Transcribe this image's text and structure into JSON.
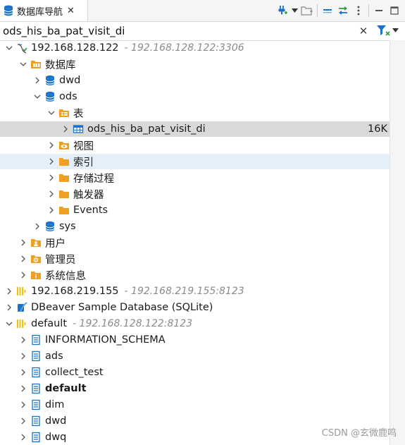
{
  "window": {
    "tab_title": "数据库导航",
    "close_label": "✕"
  },
  "toolbar": {
    "buttons": [
      {
        "icon": "new-connection-icon"
      },
      {
        "icon": "dropdown-arrow-icon"
      },
      {
        "icon": "new-folder-icon"
      },
      {
        "icon": "collapse-all-icon"
      },
      {
        "icon": "link-with-editor-icon"
      },
      {
        "icon": "view-menu-icon"
      },
      {
        "icon": "minimize-icon"
      },
      {
        "icon": "maximize-icon"
      }
    ]
  },
  "filter": {
    "value": "ods_his_ba_pat_visit_di",
    "clear_label": "✕"
  },
  "colors": {
    "chevron": "#555555",
    "database": "#1a73c8",
    "folder": "#f0a020",
    "connection": "#f2c200",
    "selected_row": "#d9d9d9",
    "hover_row": "#e5effa"
  },
  "tree": [
    {
      "level": 0,
      "chevron": "down",
      "icon": "mysql-connection-icon",
      "label": "192.168.128.122",
      "sub": " - 192.168.128.122:3306"
    },
    {
      "level": 1,
      "chevron": "down",
      "icon": "databases-folder-icon",
      "label": "数据库"
    },
    {
      "level": 2,
      "chevron": "right",
      "icon": "database-icon",
      "label": "dwd"
    },
    {
      "level": 2,
      "chevron": "down",
      "icon": "database-icon",
      "label": "ods"
    },
    {
      "level": 3,
      "chevron": "down",
      "icon": "tables-folder-icon",
      "label": "表"
    },
    {
      "level": 4,
      "chevron": "right",
      "icon": "table-icon",
      "label": "ods_his_ba_pat_visit_di",
      "size": "16K",
      "state": "selected"
    },
    {
      "level": 3,
      "chevron": "right",
      "icon": "views-folder-icon",
      "label": "视图"
    },
    {
      "level": 3,
      "chevron": "right",
      "icon": "folder-icon",
      "label": "索引",
      "state": "hover"
    },
    {
      "level": 3,
      "chevron": "right",
      "icon": "folder-icon",
      "label": "存储过程"
    },
    {
      "level": 3,
      "chevron": "right",
      "icon": "folder-icon",
      "label": "触发器"
    },
    {
      "level": 3,
      "chevron": "right",
      "icon": "folder-icon",
      "label": "Events"
    },
    {
      "level": 2,
      "chevron": "right",
      "icon": "database-icon",
      "label": "sys"
    },
    {
      "level": 1,
      "chevron": "right",
      "icon": "users-folder-icon",
      "label": "用户"
    },
    {
      "level": 1,
      "chevron": "right",
      "icon": "admin-folder-icon",
      "label": "管理员"
    },
    {
      "level": 1,
      "chevron": "right",
      "icon": "system-info-icon",
      "label": "系统信息"
    },
    {
      "level": 0,
      "chevron": "right",
      "icon": "clickhouse-connection-icon",
      "label": "192.168.219.155",
      "sub": " - 192.168.219.155:8123"
    },
    {
      "level": 0,
      "chevron": "right",
      "icon": "sqlite-connection-icon",
      "label": "DBeaver Sample Database (SQLite)"
    },
    {
      "level": 0,
      "chevron": "down",
      "icon": "clickhouse-connection-icon",
      "label": "default",
      "sub": " - 192.168.128.122:8123"
    },
    {
      "level": 1,
      "chevron": "right",
      "icon": "schema-icon",
      "label": "INFORMATION_SCHEMA"
    },
    {
      "level": 1,
      "chevron": "right",
      "icon": "schema-icon",
      "label": "ads"
    },
    {
      "level": 1,
      "chevron": "right",
      "icon": "schema-icon",
      "label": "collect_test"
    },
    {
      "level": 1,
      "chevron": "right",
      "icon": "schema-icon",
      "label": "default",
      "bold": true
    },
    {
      "level": 1,
      "chevron": "right",
      "icon": "schema-icon",
      "label": "dim"
    },
    {
      "level": 1,
      "chevron": "right",
      "icon": "schema-icon",
      "label": "dwd"
    },
    {
      "level": 1,
      "chevron": "right",
      "icon": "schema-icon",
      "label": "dwq"
    }
  ],
  "watermark": "CSDN @玄微鹿鸣"
}
